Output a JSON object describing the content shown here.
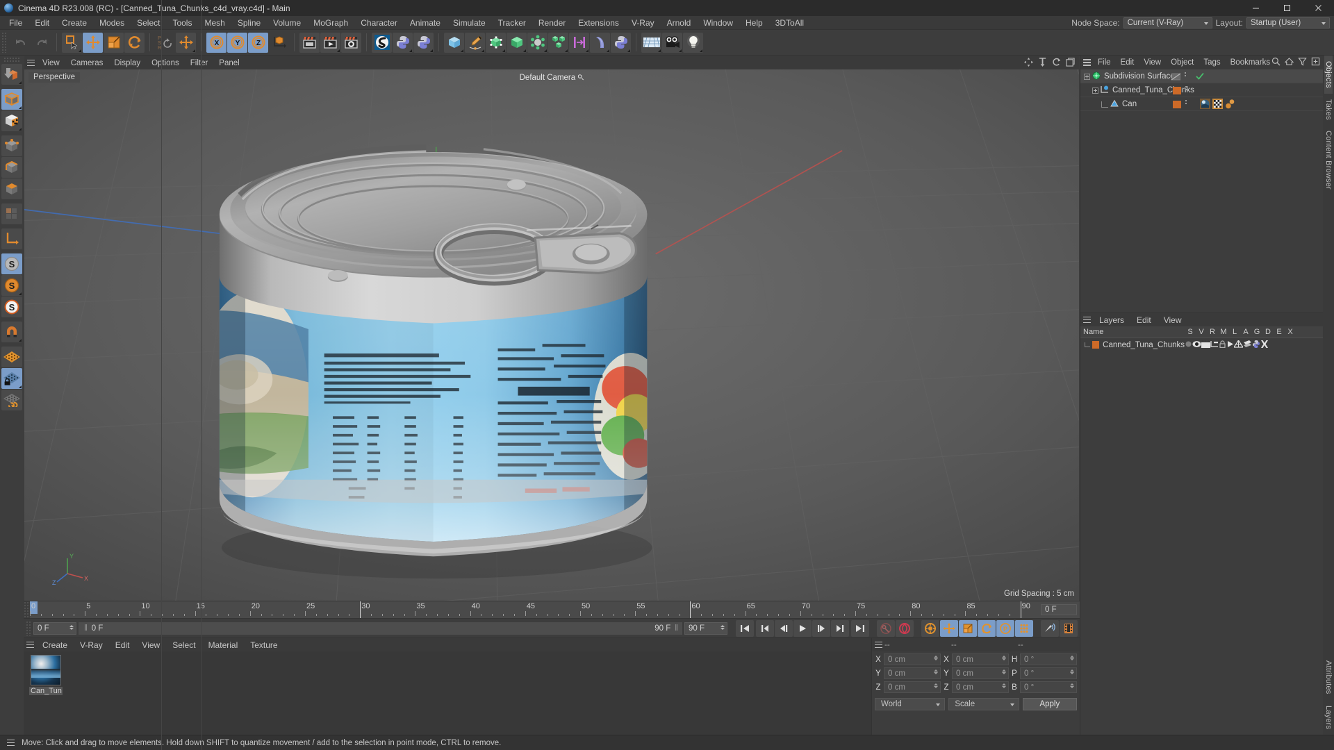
{
  "window": {
    "title": "Cinema 4D R23.008 (RC) - [Canned_Tuna_Chunks_c4d_vray.c4d] - Main",
    "minimize": "minimize-button",
    "maximize": "maximize-button",
    "close": "close-button"
  },
  "menubar": {
    "items": [
      "File",
      "Edit",
      "Create",
      "Modes",
      "Select",
      "Tools",
      "Mesh",
      "Spline",
      "Volume",
      "MoGraph",
      "Character",
      "Animate",
      "Simulate",
      "Tracker",
      "Render",
      "Extensions",
      "V-Ray",
      "Arnold",
      "Window",
      "Help",
      "3DToAll"
    ],
    "node_space_label": "Node Space:",
    "node_space_value": "Current (V-Ray)",
    "layout_label": "Layout:",
    "layout_value": "Startup (User)"
  },
  "toolbar": {
    "groups": [
      {
        "name": "undo-redo",
        "buttons": [
          {
            "name": "undo-button",
            "icon": "undo-icon",
            "active": false,
            "corner": false
          },
          {
            "name": "redo-button",
            "icon": "redo-icon",
            "active": false,
            "corner": false
          }
        ]
      },
      {
        "name": "transform",
        "buttons": [
          {
            "name": "select-tool-button",
            "icon": "select-cursor-icon",
            "active": false,
            "corner": true
          },
          {
            "name": "move-tool-button",
            "icon": "move-arrows-icon",
            "active": true,
            "corner": false
          },
          {
            "name": "scale-tool-button",
            "icon": "scale-box-icon",
            "active": false,
            "corner": false
          },
          {
            "name": "rotate-tool-button",
            "icon": "rotate-arrows-icon",
            "active": false,
            "corner": false
          }
        ]
      },
      {
        "name": "psr",
        "buttons": [
          {
            "name": "psr-lock-button",
            "icon": "psr-icon",
            "active": false,
            "corner": false
          },
          {
            "name": "world-object-axis-button",
            "icon": "move-axis-icon",
            "active": false,
            "corner": true
          }
        ]
      },
      {
        "name": "axis-lock",
        "buttons": [
          {
            "name": "x-axis-lock-button",
            "icon": "x-axis-icon",
            "active": true,
            "corner": false
          },
          {
            "name": "y-axis-lock-button",
            "icon": "y-axis-icon",
            "active": true,
            "corner": false
          },
          {
            "name": "z-axis-lock-button",
            "icon": "z-axis-icon",
            "active": true,
            "corner": false
          },
          {
            "name": "world-coordinate-button",
            "icon": "world-axis-icon",
            "active": false,
            "corner": false
          }
        ]
      },
      {
        "name": "render",
        "buttons": [
          {
            "name": "render-view-button",
            "icon": "render-view-icon",
            "active": false,
            "corner": false
          },
          {
            "name": "render-to-picture-viewer-button",
            "icon": "render-picture-icon",
            "active": false,
            "corner": true
          },
          {
            "name": "render-settings-button",
            "icon": "render-settings-icon",
            "active": false,
            "corner": false
          }
        ]
      },
      {
        "name": "plugins",
        "buttons": [
          {
            "name": "substance-button",
            "icon": "substance-icon",
            "active": false,
            "corner": false
          },
          {
            "name": "python-button-1",
            "icon": "python-icon",
            "active": false,
            "corner": true
          },
          {
            "name": "python-button-2",
            "icon": "python-icon",
            "active": false,
            "corner": true
          }
        ]
      },
      {
        "name": "primitives",
        "buttons": [
          {
            "name": "cube-primitive-button",
            "icon": "blue-cube-icon",
            "active": false,
            "corner": true
          },
          {
            "name": "spline-pen-button",
            "icon": "pen-spline-icon",
            "active": false,
            "corner": true
          },
          {
            "name": "generator-button",
            "icon": "green-cube-points-icon",
            "active": false,
            "corner": true
          },
          {
            "name": "nurbs-button",
            "icon": "green-cube-icon",
            "active": false,
            "corner": true
          },
          {
            "name": "deformer-button",
            "icon": "green-atom-icon",
            "active": false,
            "corner": true
          },
          {
            "name": "mograph-button",
            "icon": "green-cubes-icon",
            "active": false,
            "corner": true
          },
          {
            "name": "field-button",
            "icon": "pink-field-icon",
            "active": false,
            "corner": true
          },
          {
            "name": "character-button",
            "icon": "blue-bend-icon",
            "active": false,
            "corner": true
          },
          {
            "name": "python-generator-button",
            "icon": "python-icon",
            "active": false,
            "corner": true
          }
        ]
      },
      {
        "name": "scene",
        "buttons": [
          {
            "name": "floor-button",
            "icon": "floor-grid-icon",
            "active": false,
            "corner": true
          },
          {
            "name": "camera-button",
            "icon": "camera-icon",
            "active": false,
            "corner": true
          },
          {
            "name": "light-button",
            "icon": "light-bulb-icon",
            "active": false,
            "corner": true
          }
        ]
      }
    ]
  },
  "leftbar": {
    "buttons": [
      {
        "name": "make-editable-button",
        "icon": "make-editable-icon",
        "active": false,
        "corner": true
      },
      {
        "name": "model-mode-button",
        "icon": "model-cube-icon",
        "active": true,
        "corner": true
      },
      {
        "name": "texture-mode-button",
        "icon": "texture-cube-icon",
        "active": false,
        "corner": true
      },
      {
        "name": "point-mode-button",
        "icon": "point-cube-icon",
        "active": false,
        "corner": false
      },
      {
        "name": "edge-mode-button",
        "icon": "edge-cube-icon",
        "active": false,
        "corner": false
      },
      {
        "name": "polygon-mode-button",
        "icon": "polygon-cube-icon",
        "active": false,
        "corner": false
      },
      {
        "name": "uv-mode-button",
        "icon": "uv-polygon-icon",
        "active": false,
        "corner": false
      },
      {
        "name": "axis-modify-button",
        "icon": "axis-corner-icon",
        "active": false,
        "corner": false
      },
      {
        "name": "snap-enable-button",
        "icon": "snap-s-grey-icon",
        "active": true,
        "corner": false
      },
      {
        "name": "snap-quantize-button",
        "icon": "snap-s-orange-icon",
        "active": false,
        "corner": true
      },
      {
        "name": "snap-settings-button",
        "icon": "snap-s-white-icon",
        "active": false,
        "corner": false
      },
      {
        "name": "magnet-button",
        "icon": "magnet-icon",
        "active": false,
        "corner": true
      },
      {
        "name": "workplane-button",
        "icon": "workplane-icon",
        "active": false,
        "corner": false
      },
      {
        "name": "workplane-lock-button",
        "icon": "workplane-lock-icon",
        "active": true,
        "corner": true
      },
      {
        "name": "workplane-rotate-button",
        "icon": "workplane-rotate-icon",
        "active": false,
        "corner": false
      }
    ]
  },
  "viewport": {
    "menu": [
      "View",
      "Cameras",
      "Display",
      "Options",
      "Filter",
      "Panel"
    ],
    "label": "Perspective",
    "camera_label": "Default Camera",
    "grid_spacing": "Grid Spacing : 5 cm",
    "axis_x": "X",
    "axis_y": "Y",
    "axis_z": "Z",
    "corner_icons": [
      "move-viewport-icon",
      "zoom-viewport-icon",
      "rotate-viewport-icon",
      "maximize-viewport-icon"
    ]
  },
  "timeline": {
    "ticks": [
      0,
      5,
      10,
      15,
      20,
      25,
      30,
      35,
      40,
      45,
      50,
      55,
      60,
      65,
      70,
      75,
      80,
      85,
      90
    ],
    "current_frame": "0 F",
    "end_frame_box": "0 F",
    "playhead_frames": [
      0,
      30,
      60,
      90
    ]
  },
  "transport": {
    "start_field": "0 F",
    "current_field": "0 F",
    "end_label": "90 F",
    "end_field": "90 F",
    "buttons": [
      {
        "name": "go-to-start-button",
        "icon": "skip-start-icon",
        "active": false
      },
      {
        "name": "previous-keyframe-button",
        "icon": "prev-key-icon",
        "active": false
      },
      {
        "name": "previous-frame-button",
        "icon": "prev-frame-icon",
        "active": false
      },
      {
        "name": "play-button",
        "icon": "play-icon",
        "active": false
      },
      {
        "name": "next-frame-button",
        "icon": "next-frame-icon",
        "active": false
      },
      {
        "name": "next-keyframe-button",
        "icon": "next-key-icon",
        "active": false
      },
      {
        "name": "go-to-end-button",
        "icon": "skip-end-icon",
        "active": false
      },
      {
        "name": "record-active-objects-button",
        "icon": "key-icon",
        "active": false
      },
      {
        "name": "autokeying-button",
        "icon": "record-circle-icon",
        "active": false
      },
      {
        "name": "keyframe-selection-button",
        "icon": "keyframe-gear-icon",
        "active": false
      },
      {
        "name": "position-key-button",
        "icon": "position-key-icon",
        "active": true
      },
      {
        "name": "scale-key-button",
        "icon": "scale-key-icon",
        "active": true
      },
      {
        "name": "rotation-key-button",
        "icon": "rotation-key-icon",
        "active": true
      },
      {
        "name": "param-key-button",
        "icon": "param-key-icon",
        "active": true
      },
      {
        "name": "point-level-animation-button",
        "icon": "pla-dots-icon",
        "active": true
      },
      {
        "name": "sound-button",
        "icon": "sound-icon",
        "active": false
      },
      {
        "name": "timeline-button",
        "icon": "film-strip-icon",
        "active": false
      }
    ]
  },
  "material_manager": {
    "menu": [
      "Create",
      "V-Ray",
      "Edit",
      "View",
      "Select",
      "Material",
      "Texture"
    ],
    "materials": [
      {
        "name": "Can_Tun"
      }
    ]
  },
  "coordinates": {
    "headers": [
      "--",
      "--",
      "--"
    ],
    "rows": [
      {
        "pos_label": "X",
        "pos_value": "0 cm",
        "size_label": "X",
        "size_value": "0 cm",
        "rot_label": "H",
        "rot_value": "0 °"
      },
      {
        "pos_label": "Y",
        "pos_value": "0 cm",
        "size_label": "Y",
        "size_value": "0 cm",
        "rot_label": "P",
        "rot_value": "0 °"
      },
      {
        "pos_label": "Z",
        "pos_value": "0 cm",
        "size_label": "Z",
        "size_value": "0 cm",
        "rot_label": "B",
        "rot_value": "0 °"
      }
    ],
    "system": "World",
    "mode": "Scale",
    "apply": "Apply"
  },
  "object_manager": {
    "menu": [
      "File",
      "Edit",
      "View",
      "Object",
      "Tags",
      "Bookmarks"
    ],
    "header_icons": [
      "search-icon",
      "home-icon",
      "filter-icon",
      "add-icon"
    ],
    "items": [
      {
        "name": "Subdivision Surface",
        "icon": "subdivision-surface-icon",
        "depth": 0,
        "selected": true,
        "enabled_check": true,
        "has_tag_swatch": false
      },
      {
        "name": "Canned_Tuna_Chunks",
        "icon": "null-object-icon",
        "depth": 1,
        "selected": false,
        "enabled_check": false,
        "has_tag_swatch": true
      },
      {
        "name": "Can",
        "icon": "polygon-object-icon",
        "depth": 2,
        "selected": false,
        "enabled_check": false,
        "has_tag_swatch": true,
        "tags": [
          "material-tag-icon",
          "uv-tag-icon",
          "phong-tag-icon"
        ]
      }
    ]
  },
  "layer_manager": {
    "menu": [
      "Layers",
      "Edit",
      "View"
    ],
    "columns": [
      "Name",
      "S",
      "V",
      "R",
      "M",
      "L",
      "A",
      "G",
      "D",
      "E",
      "X"
    ],
    "rows": [
      {
        "name": "Canned_Tuna_Chunks",
        "color": "#cd6a28"
      }
    ]
  },
  "right_tabs": [
    "Objects",
    "Takes",
    "Content Browser",
    "Attributes",
    "Layers"
  ],
  "statusbar": {
    "text": "Move: Click and drag to move elements. Hold down SHIFT to quantize movement / add to the selection in point mode, CTRL to remove."
  },
  "colors": {
    "accent_blue": "#7b9dc9",
    "orange": "#cd6a28",
    "panel_bg": "#3d3d3d",
    "header_bg": "#3a3a3a"
  }
}
